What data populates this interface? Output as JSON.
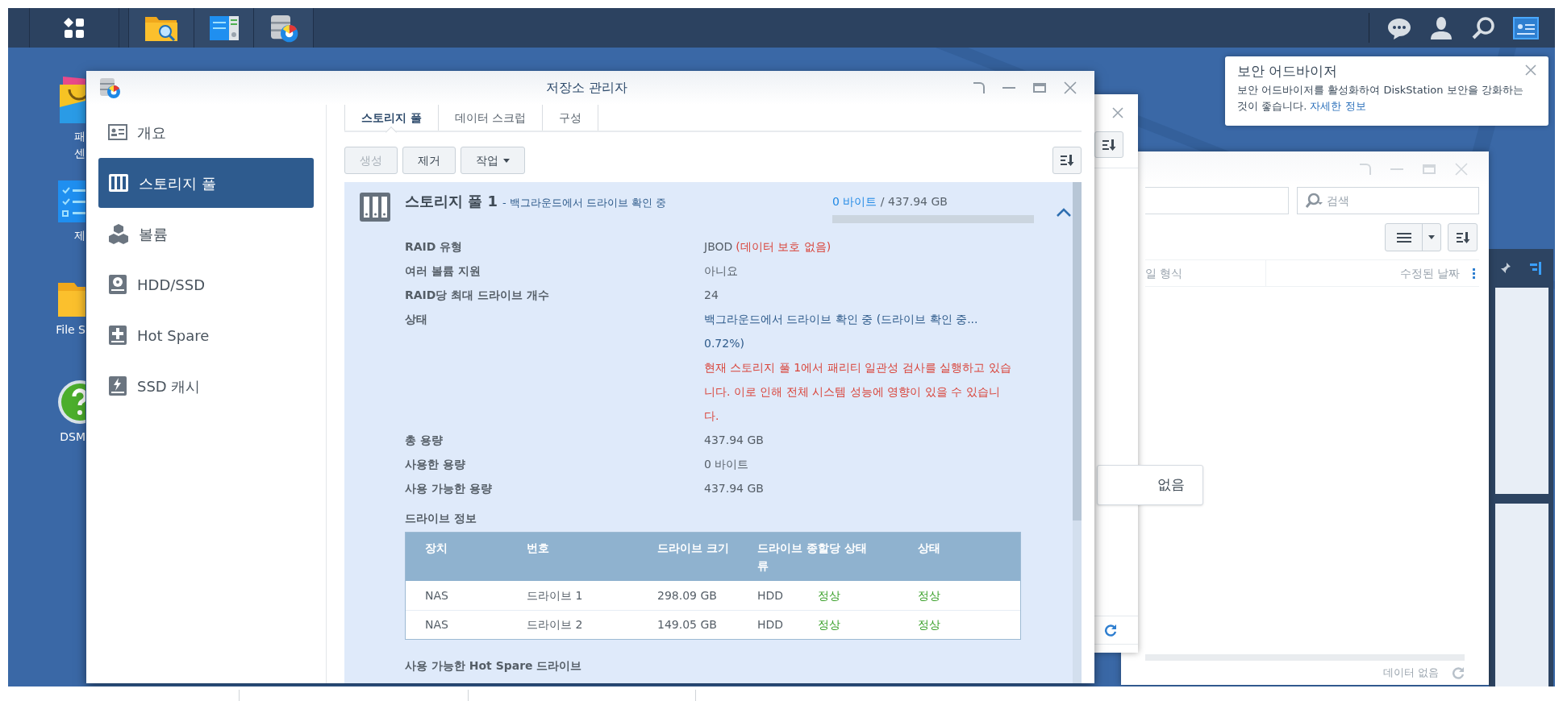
{
  "desktop_icons": [
    {
      "label": "패",
      "label_2": "센"
    },
    {
      "label": "제"
    },
    {
      "label": "File S"
    },
    {
      "label": "DSM"
    }
  ],
  "main_window": {
    "title": "저장소 관리자",
    "sidebar": {
      "items": [
        {
          "label": "개요",
          "selected": false,
          "kind": "overview"
        },
        {
          "label": "스토리지 풀",
          "selected": true,
          "kind": "pool"
        },
        {
          "label": "볼륨",
          "selected": false,
          "kind": "volume"
        },
        {
          "label": "HDD/SSD",
          "selected": false,
          "kind": "disk"
        },
        {
          "label": "Hot Spare",
          "selected": false,
          "kind": "spare"
        },
        {
          "label": "SSD 캐시",
          "selected": false,
          "kind": "cache"
        }
      ]
    },
    "tabs": [
      {
        "label": "스토리지 풀",
        "selected": true
      },
      {
        "label": "데이터 스크럽",
        "selected": false
      },
      {
        "label": "구성",
        "selected": false
      }
    ],
    "toolbar": [
      {
        "label": "생성",
        "disabled": true,
        "kind": "plain"
      },
      {
        "label": "제거",
        "disabled": false,
        "kind": "plain"
      },
      {
        "label": "작업",
        "disabled": false,
        "kind": "menu"
      }
    ],
    "pool": {
      "name": "스토리지 풀 1",
      "status": "- 백그라운드에서 드라이브 확인 중",
      "used": "0 바이트",
      "total": " / 437.94 GB",
      "level": 0,
      "expanded": true,
      "details": [
        {
          "label": "RAID 유형",
          "value": "JBOD",
          "note": "(데이터 보호 없음)"
        },
        {
          "label": "여러 볼륨 지원",
          "value": "아니요"
        },
        {
          "label": "RAID당 최대 드라이브 개수",
          "value": "24"
        },
        {
          "label": "상태",
          "value": "백그라운드에서 드라이브 확인 중 (드라이브 확인 중... 0.72%)",
          "kind": "status",
          "warning": "현재 스토리지 풀 1에서 패리티 일관성 검사를 실행하고 있습니다. 이로 인해 전체 시스템 성능에 영향이 있을 수 있습니다."
        },
        {
          "label": "총 용량",
          "value": "437.94 GB"
        },
        {
          "label": "사용한 용량",
          "value": "0 바이트"
        },
        {
          "label": "사용 가능한 용량",
          "value": "437.94 GB"
        }
      ],
      "drives": {
        "heading": "드라이브 정보",
        "columns": [
          "장치",
          "번호",
          "드라이브 크기",
          "드라이브 종류",
          "할당 상태",
          "상태"
        ],
        "rows": [
          [
            "NAS",
            "드라이브 1",
            "298.09 GB",
            "HDD",
            "정상",
            "정상"
          ],
          [
            "NAS",
            "드라이브 2",
            "149.05 GB",
            "HDD",
            "정상",
            "정상"
          ]
        ]
      },
      "hot_spare_heading": "사용 가능한 Hot Spare 드라이브"
    }
  },
  "file_window": {
    "search_placeholder": "검색",
    "columns": [
      "일 형식",
      "수정된 날짜"
    ],
    "empty_tip": "없음",
    "status": "데이터 없음"
  },
  "notification": {
    "title": "보안 어드바이저",
    "body": "보안 어드바이저를 활성화하여 DiskStation 보안을 강화하는 것이 좋습니다.",
    "link": "자세한 정보"
  }
}
